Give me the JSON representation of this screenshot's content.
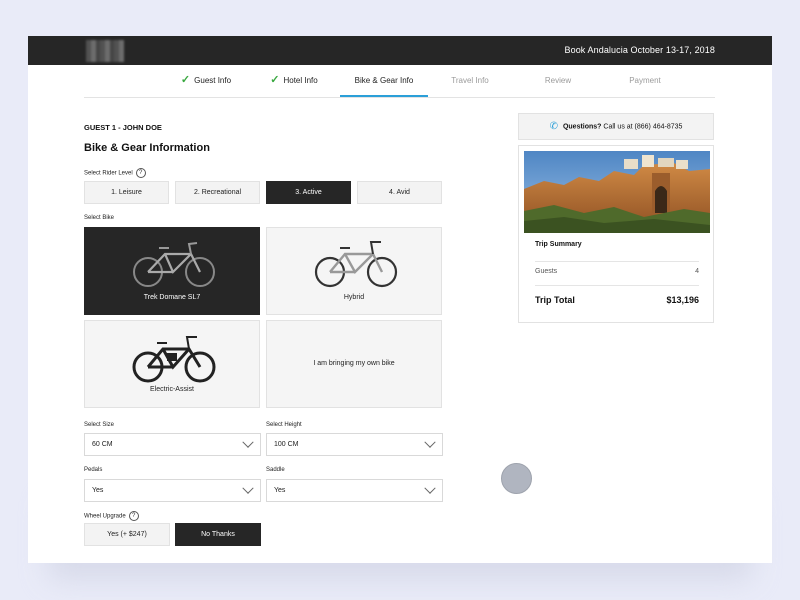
{
  "header": {
    "title": "Book Andalucia October 13-17, 2018"
  },
  "steps": [
    {
      "label": "Guest Info",
      "state": "done"
    },
    {
      "label": "Hotel Info",
      "state": "done"
    },
    {
      "label": "Bike & Gear Info",
      "state": "active"
    },
    {
      "label": "Travel Info",
      "state": "inactive"
    },
    {
      "label": "Review",
      "state": "inactive"
    },
    {
      "label": "Payment",
      "state": "inactive"
    }
  ],
  "form": {
    "guest_label": "GUEST 1 - JOHN DOE",
    "section_title": "Bike & Gear Information",
    "rider_level_label": "Select Rider Level",
    "rider_levels": [
      "1. Leisure",
      "2. Recreational",
      "3. Active",
      "4. Avid"
    ],
    "rider_level_selected": "3. Active",
    "bike_label": "Select Bike",
    "bikes": [
      "Trek Domane SL7",
      "Hybrid",
      "Electric-Assist",
      "I am bringing my own bike"
    ],
    "bike_selected": "Trek Domane SL7",
    "size_label": "Select Size",
    "size_value": "60 CM",
    "height_label": "Select Height",
    "height_value": "100 CM",
    "pedals_label": "Pedals",
    "pedals_value": "Yes",
    "saddle_label": "Saddle",
    "saddle_value": "Yes",
    "wheel_label": "Wheel Upgrade",
    "wheel_yes": "Yes (+ $247)",
    "wheel_no": "No Thanks",
    "wheel_selected": "No Thanks"
  },
  "sidebar": {
    "questions_bold": "Questions?",
    "questions_text": "Call us at (866) 464-8735",
    "summary_title": "Trip Summary",
    "guests_label": "Guests",
    "guests_value": "4",
    "total_label": "Trip Total",
    "total_value": "$13,196"
  },
  "colors": {
    "accent": "#2b9fd8",
    "check": "#39a840",
    "dark": "#262626"
  }
}
